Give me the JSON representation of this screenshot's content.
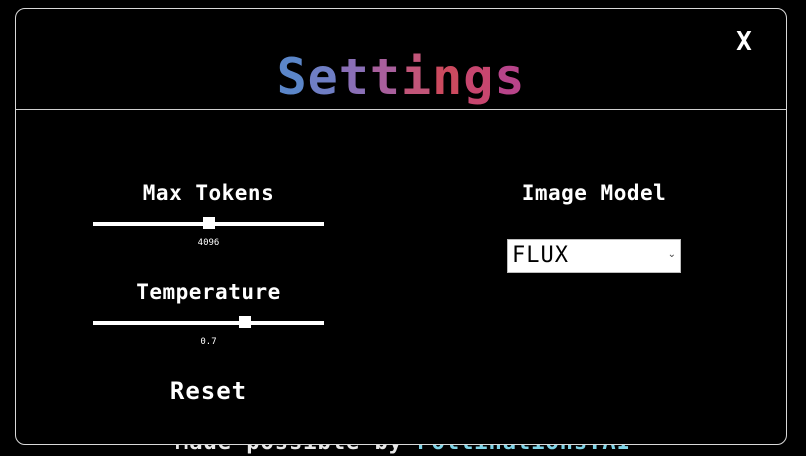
{
  "backdrop": {
    "footer_prefix": "Made possible by ",
    "footer_link": "Pollinations.AI"
  },
  "modal": {
    "title": "Settings",
    "title_colors": [
      "#5b86c9",
      "#6f7ec4",
      "#8a6fb6",
      "#a85f9c",
      "#c25579",
      "#cc4a5f",
      "#c7466f",
      "#b8448a",
      "#a244b2"
    ],
    "close_label": "X"
  },
  "max_tokens": {
    "label": "Max Tokens",
    "value_text": "4096",
    "fraction": 0.5
  },
  "temperature": {
    "label": "Temperature",
    "value_text": "0.7",
    "fraction": 0.66
  },
  "reset_label": "Reset",
  "image_model": {
    "label": "Image Model",
    "selected": "FLUX"
  }
}
